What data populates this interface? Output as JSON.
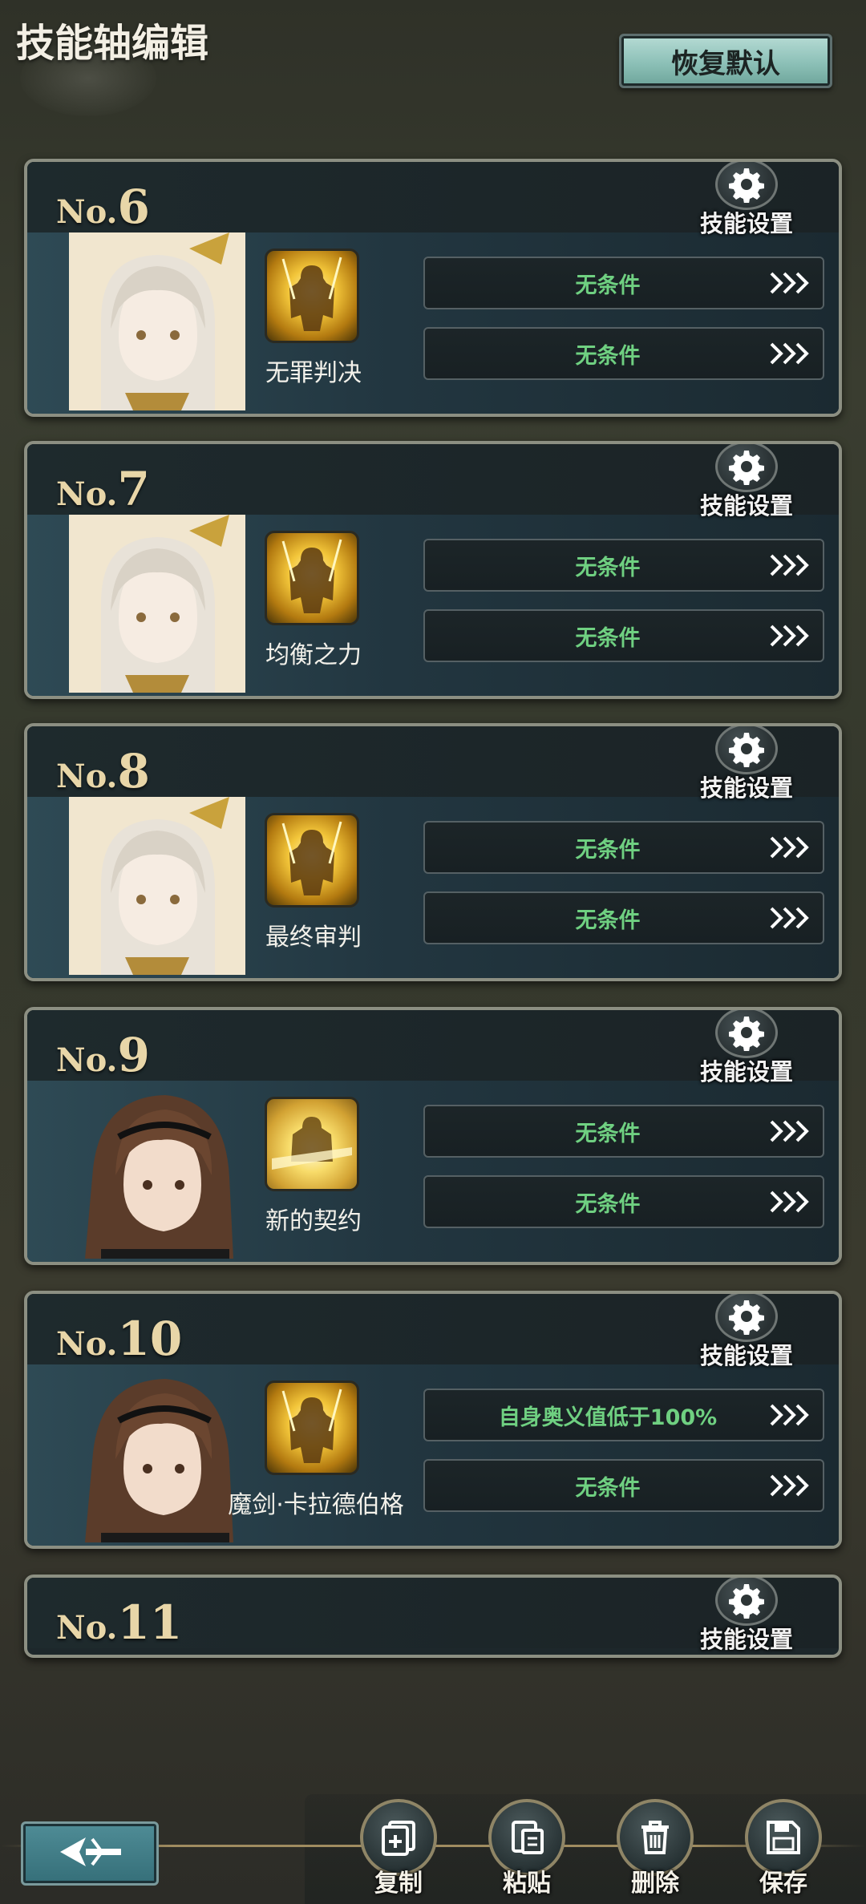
{
  "header": {
    "title": "技能轴编辑",
    "reset_label": "恢复默认"
  },
  "cards": [
    {
      "prefix": "No.",
      "number": "6",
      "gear_label": "技能设置",
      "skill_name": "无罪判决",
      "conditions": [
        "无条件",
        "无条件"
      ],
      "portrait": "white-hair-girl"
    },
    {
      "prefix": "No.",
      "number": "7",
      "gear_label": "技能设置",
      "skill_name": "均衡之力",
      "conditions": [
        "无条件",
        "无条件"
      ],
      "portrait": "white-hair-girl"
    },
    {
      "prefix": "No.",
      "number": "8",
      "gear_label": "技能设置",
      "skill_name": "最终审判",
      "conditions": [
        "无条件",
        "无条件"
      ],
      "portrait": "white-hair-girl"
    },
    {
      "prefix": "No.",
      "number": "9",
      "gear_label": "技能设置",
      "skill_name": "新的契约",
      "conditions": [
        "无条件",
        "无条件"
      ],
      "portrait": "brown-hair-girl"
    },
    {
      "prefix": "No.",
      "number": "10",
      "gear_label": "技能设置",
      "skill_name": "魔剑·卡拉德伯格",
      "conditions": [
        "自身奥义值低于100%",
        "无条件"
      ],
      "portrait": "brown-hair-girl"
    },
    {
      "prefix": "No.",
      "number": "11",
      "gear_label": "技能设置"
    }
  ],
  "actions": {
    "copy": "复制",
    "paste": "粘贴",
    "delete": "删除",
    "save": "保存"
  },
  "icons": {
    "gear": "gear-icon",
    "arrow": "triple-chevron-right-icon",
    "back": "back-arrow-icon",
    "copy": "copy-icon",
    "paste": "paste-icon",
    "delete": "trash-icon",
    "save": "floppy-icon"
  },
  "colors": {
    "condition_text": "#6fd081",
    "number_gold": "#e8d6a8",
    "reset_button": "#8cc0b7"
  }
}
